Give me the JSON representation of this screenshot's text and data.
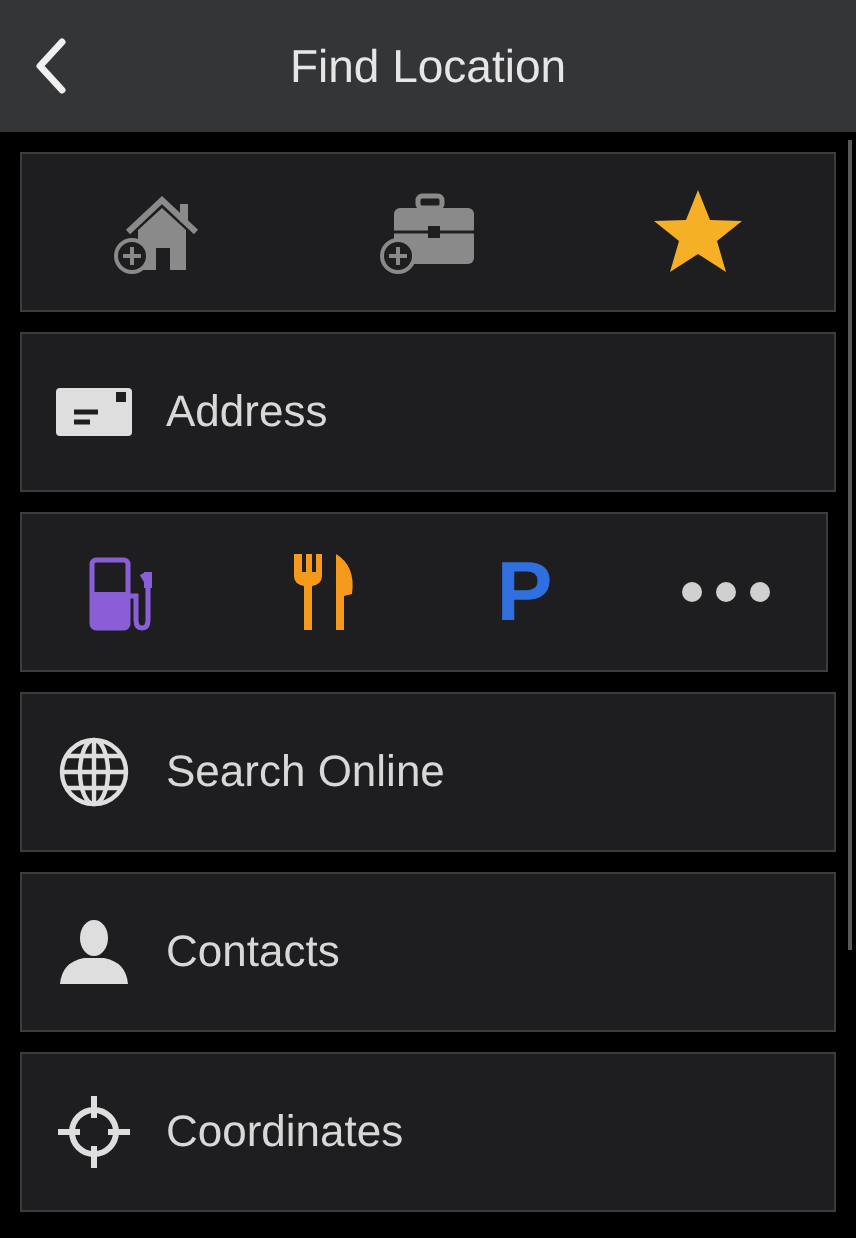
{
  "header": {
    "title": "Find Location"
  },
  "sections": [
    {
      "kind": "shortcuts",
      "items": [
        {
          "kind": "add-home"
        },
        {
          "kind": "add-work"
        },
        {
          "kind": "favorites",
          "color": "#f5b026"
        }
      ]
    },
    {
      "kind": "address",
      "label": "Address"
    },
    {
      "kind": "categories",
      "items": [
        {
          "kind": "fuel",
          "color": "#8a5fd6"
        },
        {
          "kind": "food",
          "color": "#f59a1c"
        },
        {
          "kind": "parking",
          "label": "P",
          "color": "#2f6fe0"
        },
        {
          "kind": "more",
          "color": "#d0d0d0"
        }
      ]
    },
    {
      "kind": "search-online",
      "label": "Search Online"
    },
    {
      "kind": "contacts",
      "label": "Contacts"
    },
    {
      "kind": "coordinates",
      "label": "Coordinates"
    }
  ]
}
